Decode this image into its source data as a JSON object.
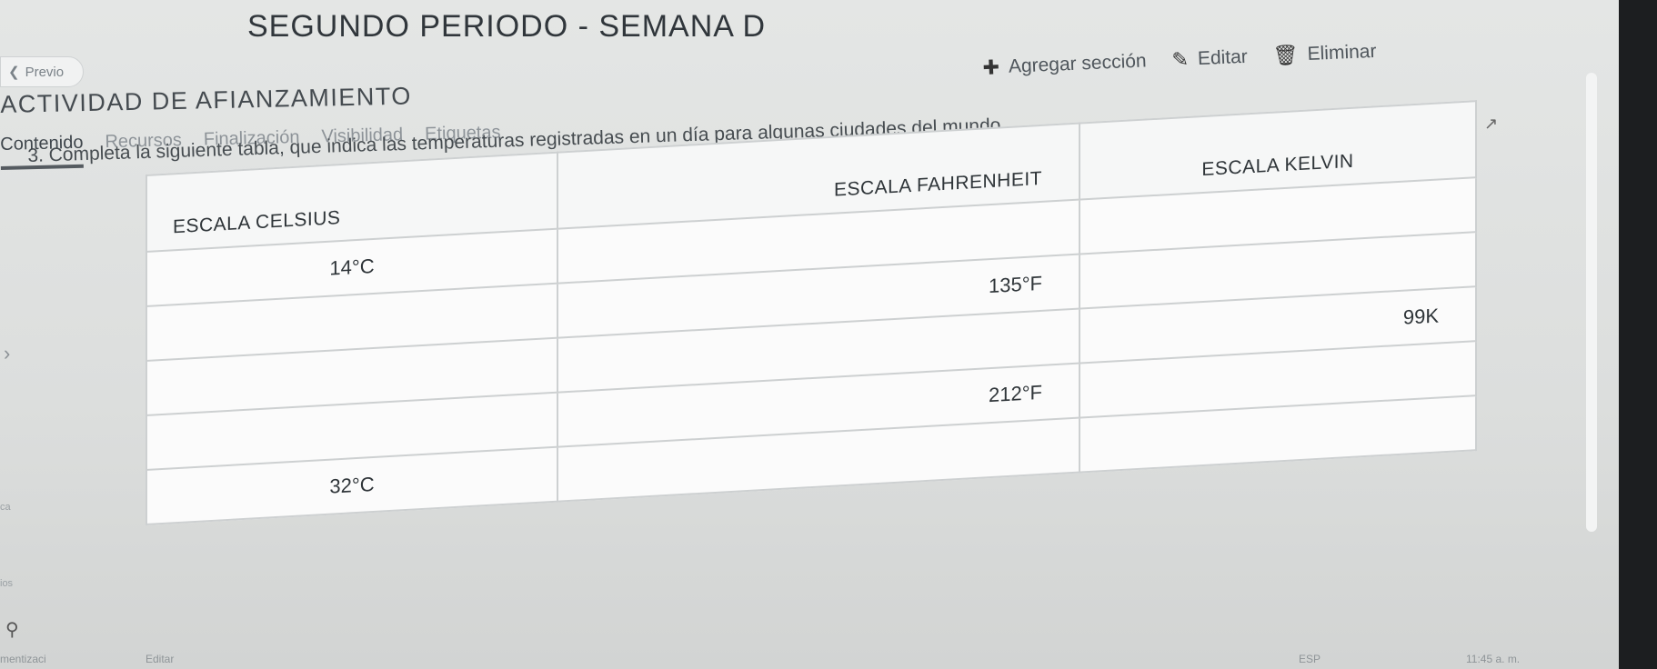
{
  "header": {
    "prev_label": "Previo",
    "title": "SEGUNDO PERIODO - SEMANA D",
    "subtitle": "ACTIVIDAD DE AFIANZAMIENTO"
  },
  "toolbar": {
    "add_section_label": "Agregar sección",
    "edit_label": "Editar",
    "delete_label": "Eliminar"
  },
  "tabs": [
    {
      "label": "Contenido"
    },
    {
      "label": "Recursos"
    },
    {
      "label": "Finalización"
    },
    {
      "label": "Visibilidad"
    },
    {
      "label": "Etiquetas"
    }
  ],
  "content": {
    "instruction": "3. Completa la siguiente tabla, que indica las temperaturas registradas en un día para algunas ciudades del mundo."
  },
  "table": {
    "headers": [
      "ESCALA CELSIUS",
      "ESCALA FAHRENHEIT",
      "ESCALA KELVIN"
    ],
    "rows": [
      [
        "14°C",
        "",
        ""
      ],
      [
        "",
        "135°F",
        ""
      ],
      [
        "",
        "",
        "99K"
      ],
      [
        "",
        "212°F",
        ""
      ],
      [
        "32°C",
        "",
        ""
      ]
    ]
  },
  "sidebar_fragments": {
    "frag1": "ca",
    "frag2": "ios"
  },
  "bottom_bar": {
    "left_text": "mentizaci",
    "edit_label": "Editar",
    "lang": "ESP",
    "time": "11:45 a. m."
  },
  "colors": {
    "accent": "#555b60",
    "screen_bg": "#e0e2e1",
    "bezel": "#1c1e20"
  }
}
